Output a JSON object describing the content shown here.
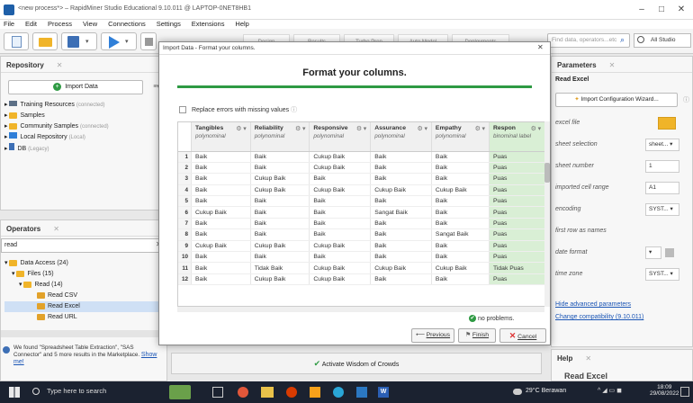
{
  "window": {
    "title": "<new process*> – RapidMiner Studio Educational 9.10.011 @ LAPTOP-0NET8HB1"
  },
  "menu": [
    "File",
    "Edit",
    "Process",
    "View",
    "Connections",
    "Settings",
    "Extensions",
    "Help"
  ],
  "toolbar": {
    "nav_tabs": [
      "Design",
      "Results",
      "Turbo Prep",
      "Auto Model",
      "Deployments"
    ],
    "search_placeholder": "Find data, operators...etc",
    "studio_label": "All Studio"
  },
  "repository": {
    "title": "Repository",
    "import_label": "Import Data",
    "items": [
      {
        "label": "Training Resources",
        "note": "(connected)"
      },
      {
        "label": "Samples",
        "note": ""
      },
      {
        "label": "Community Samples",
        "note": "(connected)"
      },
      {
        "label": "Local Repository",
        "note": "(Local)"
      },
      {
        "label": "DB",
        "note": "(Legacy)"
      }
    ]
  },
  "operators": {
    "title": "Operators",
    "search_value": "read",
    "tree": [
      "Data Access (24)",
      "Files (15)",
      "Read (14)",
      "Read CSV",
      "Read Excel",
      "Read URL"
    ],
    "footer_text": "We found \"Spreadsheet Table Extraction\", \"SAS Connector\" and 5 more results in the Marketplace.",
    "footer_link": "Show me!"
  },
  "parameters": {
    "title": "Parameters",
    "operator_name": "Read Excel",
    "wizard_label": "Import Configuration Wizard...",
    "rows": [
      {
        "label": "excel file",
        "value": ""
      },
      {
        "label": "sheet selection",
        "value": "sheet..."
      },
      {
        "label": "sheet number",
        "value": "1"
      },
      {
        "label": "imported cell range",
        "value": "A1"
      },
      {
        "label": "encoding",
        "value": "SYST..."
      },
      {
        "label": "first row as names",
        "value": ""
      },
      {
        "label": "date format",
        "value": ""
      },
      {
        "label": "time zone",
        "value": "SYST..."
      }
    ],
    "hide_link": "Hide advanced parameters",
    "compat_link": "Change compatibility (9.10.011)"
  },
  "help": {
    "title": "Help",
    "operator_name": "Read Excel"
  },
  "dialog": {
    "title": "Import Data - Format your columns.",
    "heading": "Format your columns.",
    "checkbox_label": "Replace errors with missing values",
    "columns": [
      {
        "name": "Tangibles",
        "type": "polynominal"
      },
      {
        "name": "Reliability",
        "type": "polynominal"
      },
      {
        "name": "Responsive",
        "type": "polynominal"
      },
      {
        "name": "Assurance",
        "type": "polynominal"
      },
      {
        "name": "Empathy",
        "type": "polynominal"
      },
      {
        "name": "Respon",
        "type": "binominal label"
      }
    ],
    "rows": [
      [
        "1",
        "Baik",
        "Baik",
        "Cukup Baik",
        "Baik",
        "Baik",
        "Puas"
      ],
      [
        "2",
        "Baik",
        "Baik",
        "Cukup Baik",
        "Baik",
        "Baik",
        "Puas"
      ],
      [
        "3",
        "Baik",
        "Cukup Baik",
        "Baik",
        "Baik",
        "Baik",
        "Puas"
      ],
      [
        "4",
        "Baik",
        "Cukup Baik",
        "Cukup Baik",
        "Cukup Baik",
        "Cukup Baik",
        "Puas"
      ],
      [
        "5",
        "Baik",
        "Baik",
        "Baik",
        "Baik",
        "Baik",
        "Puas"
      ],
      [
        "6",
        "Cukup Baik",
        "Baik",
        "Baik",
        "Sangat Baik",
        "Baik",
        "Puas"
      ],
      [
        "7",
        "Baik",
        "Baik",
        "Baik",
        "Baik",
        "Baik",
        "Puas"
      ],
      [
        "8",
        "Baik",
        "Baik",
        "Baik",
        "Baik",
        "Sangat Baik",
        "Puas"
      ],
      [
        "9",
        "Cukup Baik",
        "Cukup Baik",
        "Cukup Baik",
        "Baik",
        "Baik",
        "Puas"
      ],
      [
        "10",
        "Baik",
        "Baik",
        "Baik",
        "Baik",
        "Baik",
        "Puas"
      ],
      [
        "11",
        "Baik",
        "Tidak Baik",
        "Cukup Baik",
        "Cukup Baik",
        "Cukup Baik",
        "Tidak Puas"
      ],
      [
        "12",
        "Baik",
        "Cukup Baik",
        "Cukup Baik",
        "Baik",
        "Baik",
        "Puas"
      ]
    ],
    "status": "no problems.",
    "buttons": {
      "previous": "Previous",
      "finish": "Finish",
      "cancel": "Cancel"
    }
  },
  "bottom_banner": "Activate Wisdom of Crowds",
  "taskbar": {
    "search_placeholder": "Type here to search",
    "weather": "29°C  Berawan",
    "time": "18:09",
    "date": "29/08/2022"
  },
  "colors": {
    "accent_green": "#2e9a43",
    "label_column": "#d9efd5",
    "link": "#1a55b5",
    "taskbar": "#1b2230"
  }
}
